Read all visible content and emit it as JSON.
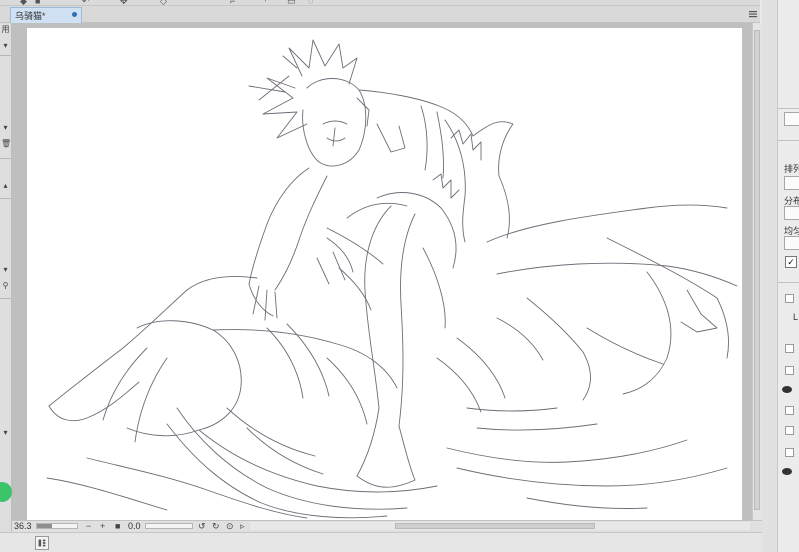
{
  "tabs": [
    {
      "label": "乌骑猫*",
      "active": true,
      "modified": true
    }
  ],
  "left_panel": {
    "partial_label": "用"
  },
  "status_bar": {
    "zoom": "36.3",
    "rotation": "0.0",
    "zoom_out": "−",
    "zoom_in": "+"
  },
  "right_panel": {
    "labels": {
      "arrange": "排列",
      "distribute": "分布",
      "even": "均匀"
    },
    "visible_marks": [
      "✓",
      "L"
    ]
  },
  "colors": {
    "accent": "#2f6fb6",
    "tab_active": "#cfe1f3",
    "sketch_line": "#5a5060",
    "green_indicator": "#3cc46a"
  },
  "icons": [
    "tab-menu-icon",
    "trash-icon",
    "eye-icon",
    "rotate-left-icon",
    "rotate-right-icon",
    "reset-rotation-icon",
    "layout-icon"
  ]
}
